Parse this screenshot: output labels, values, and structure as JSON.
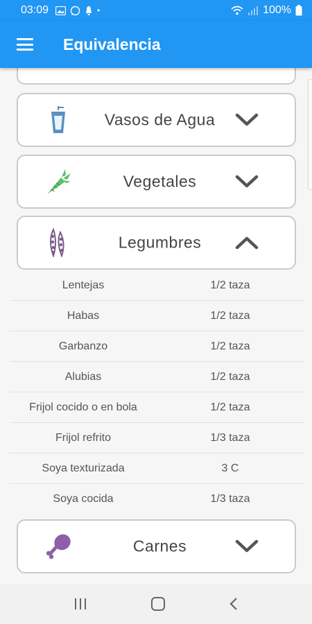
{
  "status": {
    "time": "03:09",
    "battery": "100%"
  },
  "app": {
    "title": "Equivalencia"
  },
  "cards": [
    {
      "label": "Vasos de Agua",
      "icon": "water-glass-icon",
      "expanded": false
    },
    {
      "label": "Vegetales",
      "icon": "carrot-icon",
      "expanded": false
    },
    {
      "label": "Legumbres",
      "icon": "pea-pod-icon",
      "expanded": true
    },
    {
      "label": "Carnes",
      "icon": "chicken-leg-icon",
      "expanded": false
    }
  ],
  "legumbres": [
    {
      "food": "Lentejas",
      "portion": "1/2 taza"
    },
    {
      "food": "Habas",
      "portion": "1/2 taza"
    },
    {
      "food": "Garbanzo",
      "portion": "1/2 taza"
    },
    {
      "food": "Alubias",
      "portion": "1/2 taza"
    },
    {
      "food": "Frijol cocido o en bola",
      "portion": "1/2 taza"
    },
    {
      "food": "Frijol refrito",
      "portion": "1/3 taza"
    },
    {
      "food": "Soya texturizada",
      "portion": "3 C"
    },
    {
      "food": "Soya cocida",
      "portion": "1/3 taza"
    }
  ],
  "colors": {
    "primary": "#2196f3",
    "water": "#5b8fbf",
    "carrot": "#5fbf6a",
    "legume": "#7a5a8a",
    "meat": "#8e5fa8"
  }
}
